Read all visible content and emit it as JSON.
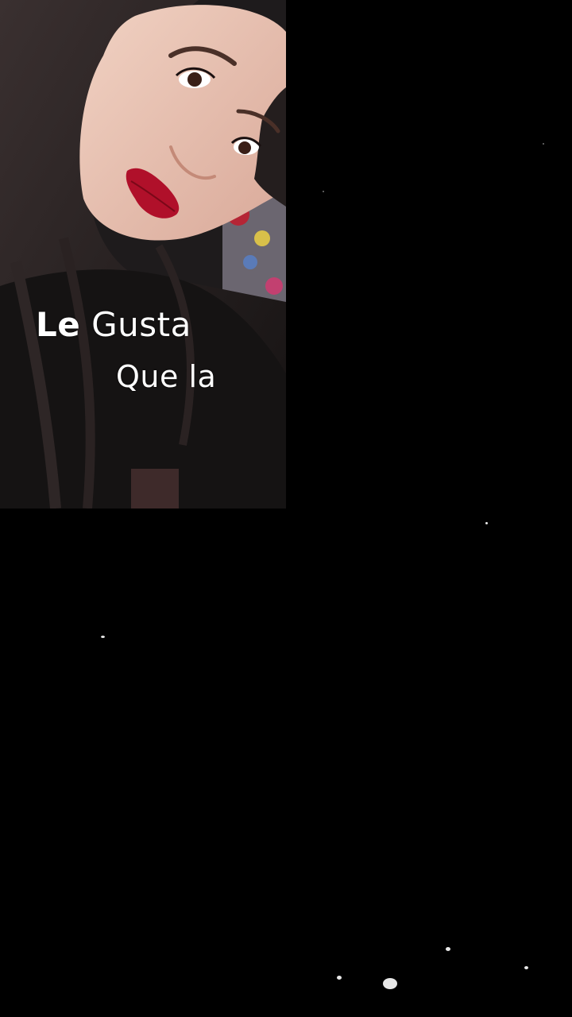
{
  "caption": {
    "line1_word1": "Le",
    "line1_word2": "Gusta",
    "line2": "Que la"
  },
  "colors": {
    "background": "#000000",
    "caption_text": "#ffffff",
    "lips": "#b0102a"
  }
}
